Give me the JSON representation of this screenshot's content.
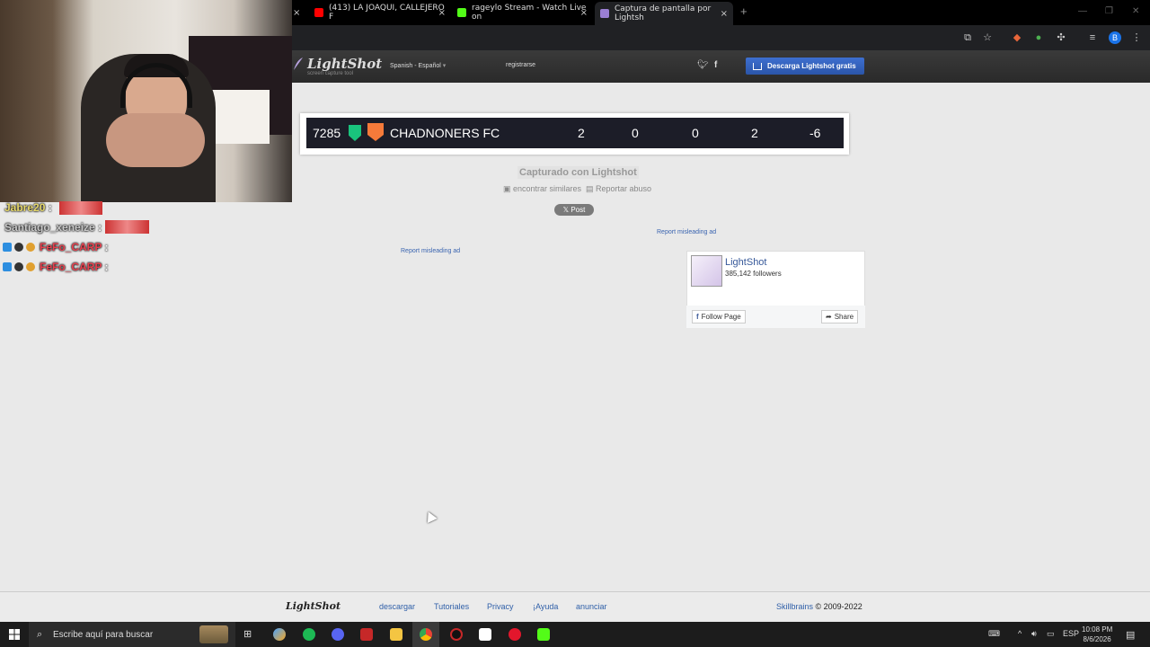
{
  "browser": {
    "tabs": [
      {
        "label": "(413) LA JOAQUI, CALLEJERO F",
        "icon": "youtube-icon",
        "color": "#ff0000"
      },
      {
        "label": "rageylo Stream - Watch Live on",
        "icon": "kick-icon",
        "color": "#53fc18"
      },
      {
        "label": "Captura de pantalla por Lightsh",
        "icon": "lightshot-icon",
        "color": "#9b7fd4"
      }
    ],
    "profile_initial": "B"
  },
  "lightshot": {
    "logo": "LightShot",
    "logo_sub": "screen capture tool",
    "language": "Spanish - Español",
    "register": "registrarse",
    "download": "Descarga Lightshot gratis",
    "captured": "Capturado con Lightshot",
    "find_similar": "encontrar similares",
    "report_abuse": "Reportar abuso",
    "post": "Post",
    "report_ad": "Report misleading ad",
    "screenshot": {
      "rank": "7285",
      "team": "CHADNONERS FC",
      "stats": [
        "2",
        "0",
        "0",
        "2",
        "-6"
      ]
    },
    "fb": {
      "name": "LightShot",
      "followers": "385,142 followers",
      "follow": "Follow Page",
      "share": "Share"
    },
    "footer": {
      "logo": "LightShot",
      "links": [
        "descargar",
        "Tutoriales",
        "Privacy",
        "¡Ayuda",
        "anunciar"
      ],
      "company": "Skillbrains",
      "copyright": "© 2009-2022"
    }
  },
  "chat": [
    {
      "user": "Jabre20",
      "text": ":",
      "color": "#e6d86b"
    },
    {
      "user": "Santiago_xeneize",
      "text": ":",
      "color": "#c8c8c8"
    },
    {
      "user": "FeFo_CARP",
      "text": ":",
      "color": "#e8424f"
    },
    {
      "user": "FeFo_CARP",
      "text": ":",
      "color": "#e8424f"
    }
  ],
  "taskbar": {
    "search_placeholder": "Escribe aquí para buscar",
    "language": "ESP",
    "time": "10:08 PM",
    "date": "8/6/2026"
  }
}
